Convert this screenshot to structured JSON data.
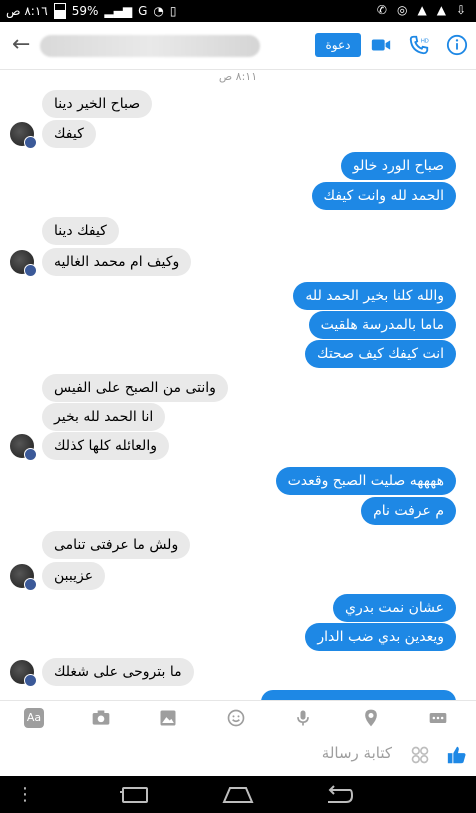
{
  "status_bar": {
    "time": "٨:١٦ ص",
    "battery": "59%",
    "network": "G"
  },
  "header": {
    "invite_label": "دعوة"
  },
  "chat": {
    "timestamp": "٨:١١ ص",
    "messages": [
      {
        "side": "in",
        "text": "صباح الخير دينا"
      },
      {
        "side": "in",
        "text": "كيفك"
      },
      {
        "side": "out",
        "text": "صباح الورد خالو"
      },
      {
        "side": "out",
        "text": "الحمد لله وانت كيفك"
      },
      {
        "side": "in",
        "text": "كيفك دينا"
      },
      {
        "side": "in",
        "text": "وكيف ام محمد الغاليه"
      },
      {
        "side": "out",
        "text": "والله كلنا بخير الحمد لله"
      },
      {
        "side": "out",
        "text": "ماما بالمدرسة هلقيت"
      },
      {
        "side": "out",
        "text": "انت كيفك كيف صحتك"
      },
      {
        "side": "in",
        "text": "وانتى من الصبح على الفيس"
      },
      {
        "side": "in",
        "text": "انا الحمد لله بخير"
      },
      {
        "side": "in",
        "text": "والعائله كلها كذلك"
      },
      {
        "side": "out",
        "text": "ههههه  صليت الصبح وقعدت"
      },
      {
        "side": "out",
        "text": "م عرفت نام"
      },
      {
        "side": "in",
        "text": "ولش ما عرفتى تنامى"
      },
      {
        "side": "in",
        "text": "عزيببن"
      },
      {
        "side": "out",
        "text": "عشان نمت بدري"
      },
      {
        "side": "out",
        "text": "ويعدين بدي ضب الدار"
      },
      {
        "side": "in",
        "text": "ما بتروحى على شغلك"
      }
    ]
  },
  "toolbar": {
    "aa_label": "Aa"
  },
  "composer": {
    "placeholder": "كتابة رسالة"
  },
  "colors": {
    "accent": "#1e88e5",
    "incoming_bubble": "#e9e9e9",
    "outgoing_bubble": "#1e88e5"
  }
}
